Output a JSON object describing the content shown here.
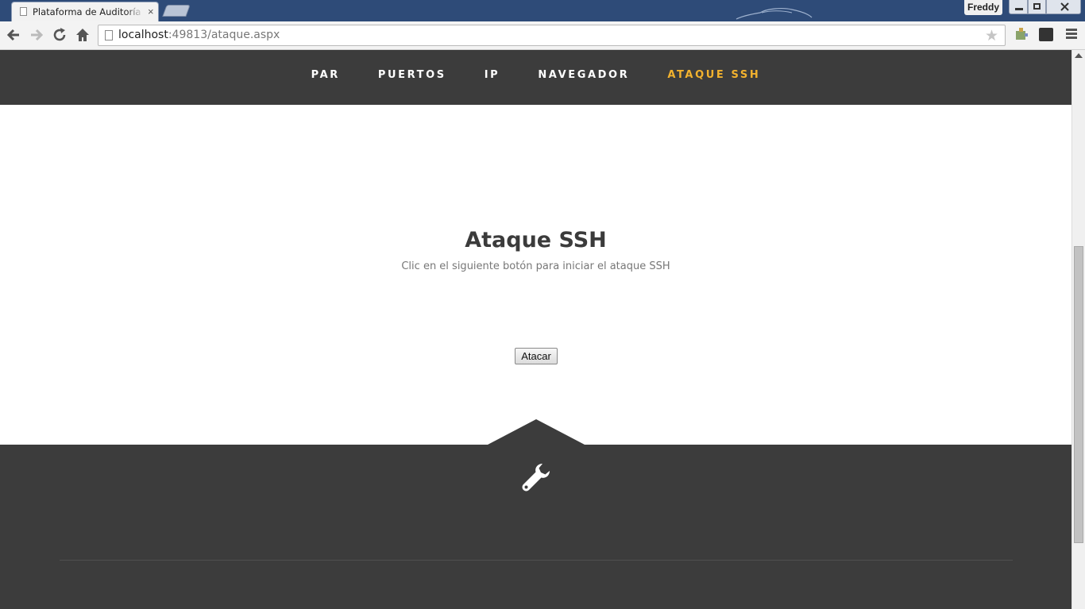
{
  "browser": {
    "tab_title": "Plataforma de Auditoría de",
    "tab_close": "×",
    "profile_name": "Freddy",
    "url_host": "localhost",
    "url_path": ":49813/ataque.aspx",
    "star": "★"
  },
  "nav": {
    "items": [
      {
        "label": "PAR"
      },
      {
        "label": "PUERTOS"
      },
      {
        "label": "IP"
      },
      {
        "label": "NAVEGADOR"
      },
      {
        "label": "ATAQUE SSH",
        "active": true
      }
    ],
    "active_color": "#f2b22e"
  },
  "main": {
    "heading": "Ataque SSH",
    "subtext": "Clic en el siguiente botón para iniciar el ataque SSH",
    "button_label": "Atacar"
  },
  "footer": {
    "icon": "wrench-icon"
  }
}
